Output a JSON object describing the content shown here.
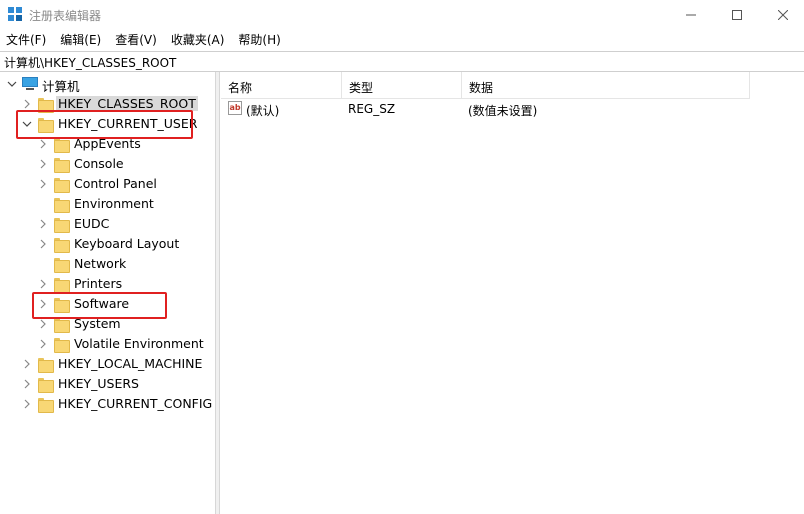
{
  "window": {
    "title": "注册表编辑器",
    "controls": {
      "minimize": "—",
      "maximize": "☐",
      "close": "✕"
    }
  },
  "menu": [
    "文件(F)",
    "编辑(E)",
    "查看(V)",
    "收藏夹(A)",
    "帮助(H)"
  ],
  "address": "计算机\\HKEY_CLASSES_ROOT",
  "tree": {
    "root": "计算机",
    "hives": {
      "classes_root": "HKEY_CLASSES_ROOT",
      "current_user": "HKEY_CURRENT_USER",
      "local_machine": "HKEY_LOCAL_MACHINE",
      "users": "HKEY_USERS",
      "current_config": "HKEY_CURRENT_CONFIG"
    },
    "current_user_children": [
      "AppEvents",
      "Console",
      "Control Panel",
      "Environment",
      "EUDC",
      "Keyboard Layout",
      "Network",
      "Printers",
      "Software",
      "System",
      "Volatile Environment"
    ]
  },
  "values": {
    "columns": [
      "名称",
      "类型",
      "数据"
    ],
    "rows": [
      {
        "name": "(默认)",
        "type": "REG_SZ",
        "data": "(数值未设置)"
      }
    ]
  },
  "colors": {
    "highlight": "#e02020",
    "folder": "#f8d775"
  }
}
